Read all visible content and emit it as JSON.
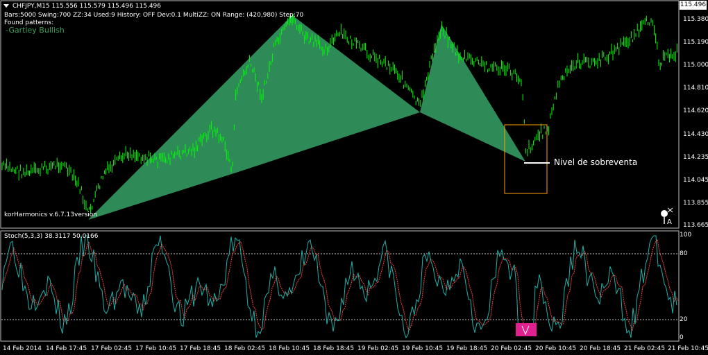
{
  "header": {
    "symbol_line": "CHFJPY,M15  115.556 115.579 115.496 115.496",
    "params_line": "Bars:5000  Swing:700  ZZ:34  Used:9  History: OFF Dev:0.1  MultiZZ: ON  Range: (420,980)  Step:70",
    "found_label": "Found patterns:",
    "pattern_name": "-Gartley Bullish"
  },
  "indicator_version": "korHarmonics v.6.7.13version",
  "annotation_label": "Nivel de sobreventa",
  "price_axis": {
    "current": "115.496",
    "labels": [
      "115.380",
      "115.190",
      "115.000",
      "114.810",
      "114.620",
      "114.430",
      "114.235",
      "114.045",
      "113.855",
      "113.665"
    ]
  },
  "oscillator": {
    "title": "Stoch(5,3,3) 38.3117 50.0166",
    "levels": [
      "100",
      "80",
      "20",
      "0"
    ]
  },
  "time_axis": [
    "14 Feb 2014",
    "14 Feb 17:45",
    "17 Feb 02:45",
    "17 Feb 10:45",
    "17 Feb 18:45",
    "18 Feb 02:45",
    "18 Feb 10:45",
    "18 Feb 18:45",
    "19 Feb 02:45",
    "19 Feb 10:45",
    "19 Feb 18:45",
    "20 Feb 02:45",
    "20 Feb 10:45",
    "20 Feb 18:45",
    "21 Feb 02:45",
    "21 Feb 10:45"
  ],
  "colors": {
    "background": "#000000",
    "candles": "#00ff00",
    "pattern_fill": "#2e8b57",
    "stoch_main": "#20b2aa",
    "stoch_signal": "#ff4040",
    "oversold_box": "#ffa500",
    "oscillator_marker": "#e0208c"
  },
  "icons": [
    "dropdown-triangle-icon",
    "signal-icon"
  ]
}
